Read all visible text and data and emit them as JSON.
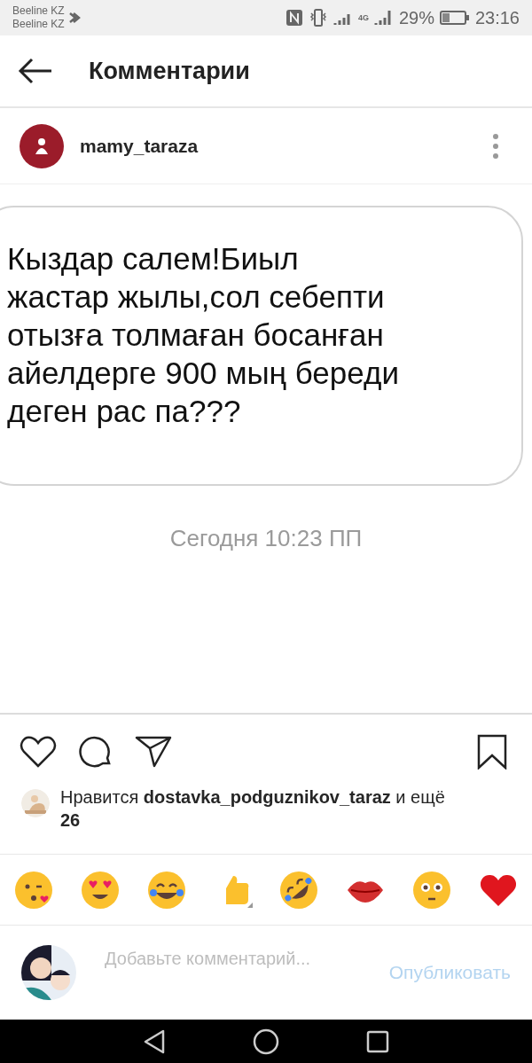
{
  "status_bar": {
    "carriers": [
      "Beeline KZ",
      "Beeline KZ"
    ],
    "network": "4G",
    "battery": "29%",
    "time": "23:16"
  },
  "header": {
    "title": "Комментарии"
  },
  "post": {
    "username": "mamy_taraza",
    "message_lines": [
      "Кыздар салем!Биыл",
      "жастар жылы,сол себепти",
      "отызға толмаған босанған",
      "айелдерге 900 мың береди",
      "деген рас па???"
    ],
    "message_time": "Сегодня 10:23 ПП",
    "liked": false,
    "saved": false,
    "likes": {
      "prefix": "Нравится",
      "user": "dostavka_podguznikov_taraz",
      "suffix": "и ещё",
      "count": "26"
    }
  },
  "comment_box": {
    "placeholder": "Добавьте комментарий...",
    "publish": "Опубликовать"
  }
}
